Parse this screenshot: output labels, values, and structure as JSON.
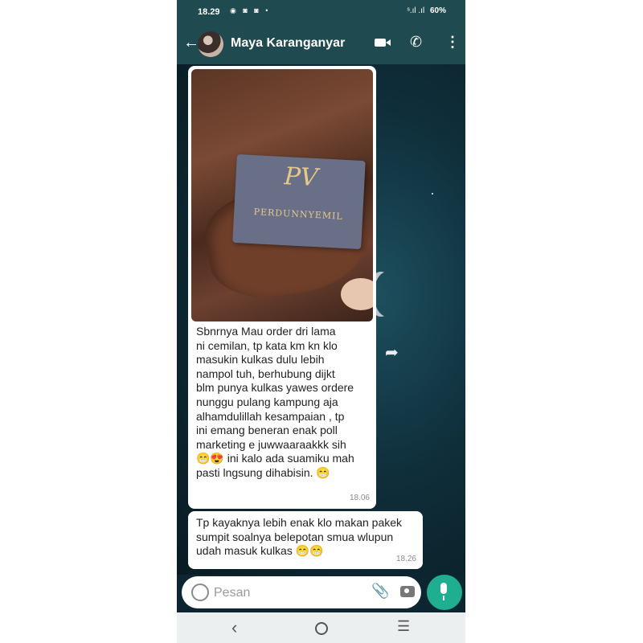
{
  "status_bar": {
    "time": "18.29",
    "notification_icons": "◉ ◙ ◙ •",
    "signal": "ˢ.ıl .ıl",
    "battery": "60%"
  },
  "chat_header": {
    "contact_name": "Maya Karanganyar"
  },
  "messages": [
    {
      "has_image": true,
      "card_logo": "PV",
      "card_brand": "PERDUNNYEMIL",
      "text": "Sbnrnya Mau order dri lama\nni cemilan, tp kata km kn klo\nmasukin kulkas dulu lebih\nnampol tuh, berhubung dijkt\nblm punya kulkas yawes ordere\nnunggu pulang kampung aja\nalhamdulillah kesampaian , tp\nini emang beneran enak poll\nmarketing e juwwaaraakkk sih\n😁😍 ini kalo ada suamiku mah\npasti lngsung dihabisin. 😁",
      "time": "18.06"
    },
    {
      "has_image": false,
      "text": "Tp kayaknya lebih enak klo makan pakek\nsumpit soalnya belepotan smua wlupun\nudah masuk kulkas 😁😁",
      "time": "18.26"
    }
  ],
  "composer": {
    "placeholder": "Pesan"
  },
  "icons": {
    "back": "back-arrow-icon",
    "video": "video-call-icon",
    "call": "phone-call-icon",
    "more": "more-options-icon",
    "emoji": "emoji-icon",
    "attach": "paperclip-icon",
    "camera": "camera-icon",
    "mic": "microphone-icon",
    "forward": "forward-icon"
  },
  "colors": {
    "header": "#1f4a4f",
    "mic_button": "#1fae8f",
    "bubble": "#ffffff"
  }
}
